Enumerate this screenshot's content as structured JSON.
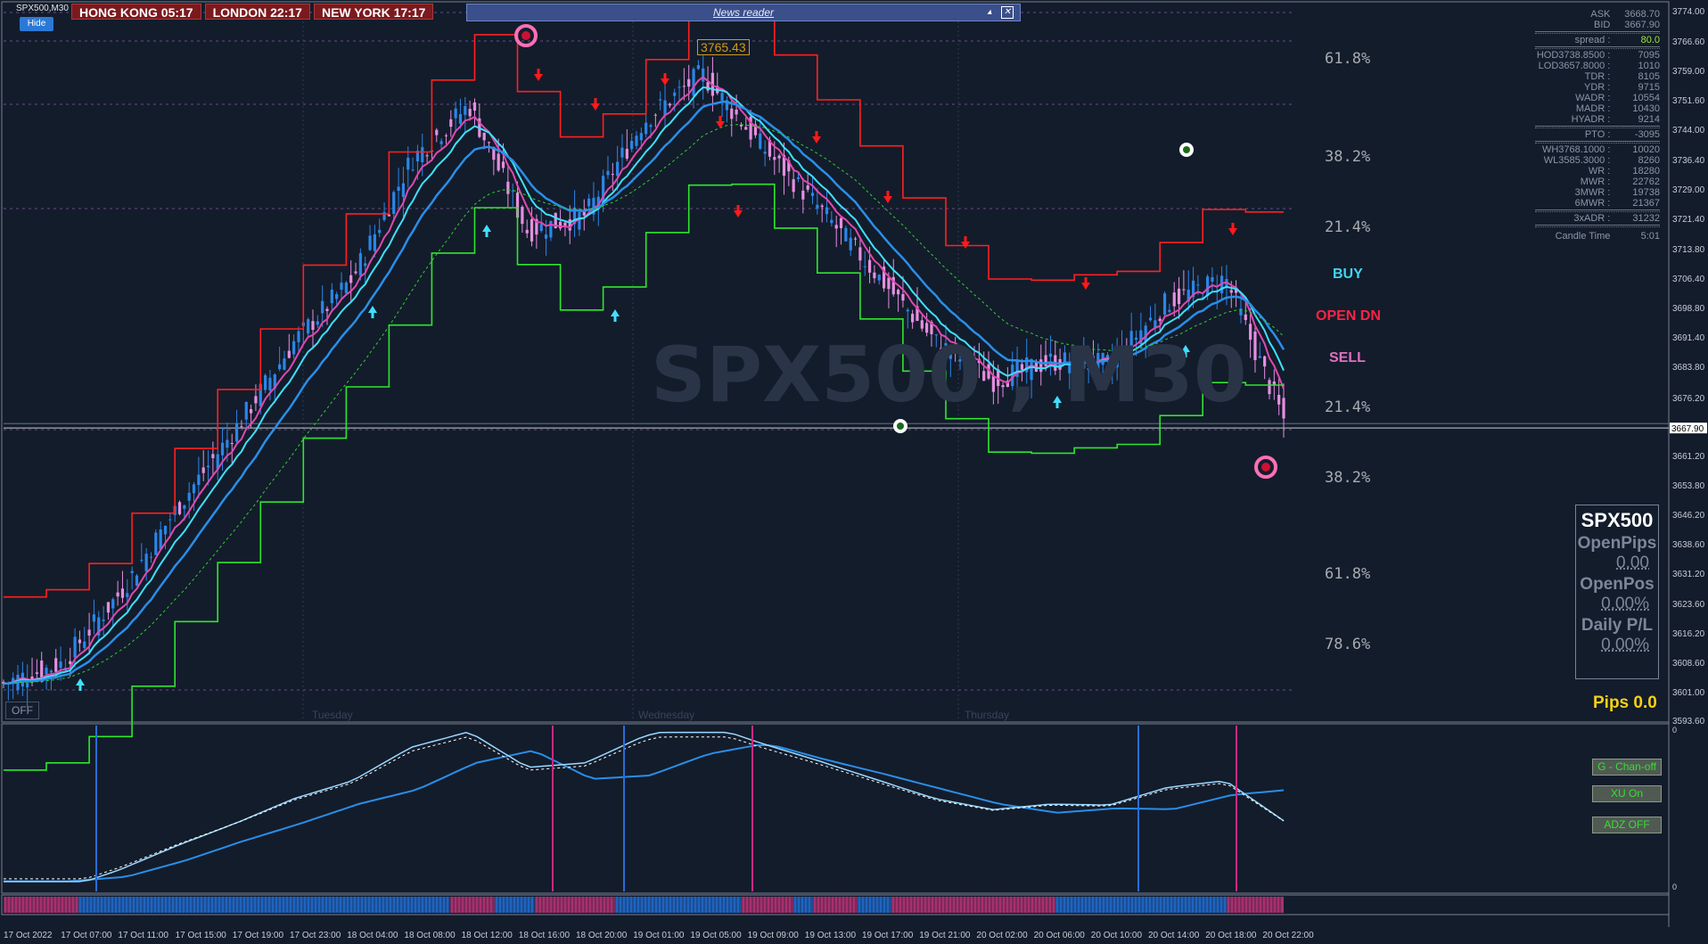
{
  "window": {
    "symbol_title": "SPX500,M30",
    "watermark": "SPX500 , M30"
  },
  "clocks": [
    {
      "label": "HONG KONG 05:17"
    },
    {
      "label": "LONDON  22:17"
    },
    {
      "label": "NEW YORK  17:17"
    }
  ],
  "news_reader": {
    "title": "News reader",
    "minimize": "▴",
    "close": "✕"
  },
  "buttons": {
    "hide": "Hide",
    "off": "OFF",
    "g_chan": "G - Chan-off",
    "xu_on": "XU On",
    "adz_off": "ADZ OFF"
  },
  "price_tag": "3765.43",
  "current_price": "3667.90",
  "signals": {
    "buy": "BUY",
    "open_dn": "OPEN  DN",
    "sell": "SELL"
  },
  "fib_levels": [
    "61.8%",
    "38.2%",
    "21.4%",
    "21.4%",
    "38.2%",
    "61.8%",
    "78.6%"
  ],
  "info_panel": {
    "ask_label": "ASK",
    "ask": "3668.70",
    "bid_label": "BID",
    "bid": "3667.90",
    "spread_label": "spread :",
    "spread": "80.0",
    "rows1": [
      {
        "l": "HOD3738.8500 :",
        "v": "7095"
      },
      {
        "l": "LOD3657.8000 :",
        "v": "1010"
      },
      {
        "l": "TDR :",
        "v": "8105"
      },
      {
        "l": "YDR :",
        "v": "9715"
      },
      {
        "l": "WADR :",
        "v": "10554"
      },
      {
        "l": "MADR :",
        "v": "10430"
      },
      {
        "l": "HYADR :",
        "v": "9214"
      }
    ],
    "pto_label": "PTO :",
    "pto": "-3095",
    "rows2": [
      {
        "l": "WH3768.1000 :",
        "v": "10020"
      },
      {
        "l": "WL3585.3000 :",
        "v": "8260"
      },
      {
        "l": "WR :",
        "v": "18280"
      },
      {
        "l": "MWR :",
        "v": "22762"
      },
      {
        "l": "3MWR :",
        "v": "19738"
      },
      {
        "l": "6MWR :",
        "v": "21367"
      }
    ],
    "xadr_label": "3xADR :",
    "xadr": "31232",
    "candle_label": "Candle Time",
    "candle": "5:01"
  },
  "position_panel": {
    "symbol": "SPX500",
    "open_pips_label": "OpenPips",
    "open_pips": "0.00",
    "open_pos_label": "OpenPos",
    "open_pos": "0.00%",
    "daily_label": "Daily P/L",
    "daily": "0.00%"
  },
  "pips": "Pips 0.0",
  "price_axis": [
    "3774.00",
    "3766.60",
    "3759.00",
    "3751.60",
    "3744.00",
    "3736.40",
    "3729.00",
    "3721.40",
    "3713.80",
    "3706.40",
    "3698.80",
    "3691.40",
    "3683.80",
    "3676.20",
    "3661.20",
    "3653.80",
    "3646.20",
    "3638.60",
    "3631.20",
    "3623.60",
    "3616.20",
    "3608.60",
    "3601.00",
    "3593.60"
  ],
  "sub_axis": [
    "0",
    "0"
  ],
  "day_labels": [
    "Tuesday",
    "Wednesday",
    "Thursday"
  ],
  "time_axis": [
    "17 Oct 2022",
    "17 Oct 07:00",
    "17 Oct 11:00",
    "17 Oct 15:00",
    "17 Oct 19:00",
    "17 Oct 23:00",
    "18 Oct 04:00",
    "18 Oct 08:00",
    "18 Oct 12:00",
    "18 Oct 16:00",
    "18 Oct 20:00",
    "19 Oct 01:00",
    "19 Oct 05:00",
    "19 Oct 09:00",
    "19 Oct 13:00",
    "19 Oct 17:00",
    "19 Oct 21:00",
    "20 Oct 02:00",
    "20 Oct 06:00",
    "20 Oct 10:00",
    "20 Oct 14:00",
    "20 Oct 18:00",
    "20 Oct 22:00"
  ],
  "chart_data": {
    "type": "line",
    "title": "SPX500,M30",
    "ylim": [
      3593.6,
      3774.0
    ],
    "x": [
      "17 Oct 2022",
      "17 Oct 07:00",
      "17 Oct 11:00",
      "17 Oct 15:00",
      "17 Oct 19:00",
      "17 Oct 23:00",
      "18 Oct 04:00",
      "18 Oct 08:00",
      "18 Oct 12:00",
      "18 Oct 16:00",
      "18 Oct 20:00",
      "19 Oct 01:00",
      "19 Oct 05:00",
      "19 Oct 09:00",
      "19 Oct 13:00",
      "19 Oct 17:00",
      "19 Oct 21:00",
      "20 Oct 02:00",
      "20 Oct 06:00",
      "20 Oct 10:00",
      "20 Oct 14:00",
      "20 Oct 18:00",
      "20 Oct 22:00"
    ],
    "series": [
      {
        "values": [
          3603,
          3608,
          3626,
          3648,
          3668,
          3690,
          3706,
          3736,
          3750,
          3718,
          3722,
          3746,
          3758,
          3740,
          3724,
          3707,
          3690,
          3680,
          3685,
          3684,
          3700,
          3706,
          3670
        ]
      }
    ],
    "current": 3667.9,
    "colors": {
      "bull": "#2b86e8",
      "bear": "#e58fe0",
      "up_band": "#2ee62e",
      "dn_band": "#ff2020",
      "ma_pink": "#e048b0",
      "ma_cyan": "#3fe0ff",
      "ma_blue": "#2a8ee8"
    }
  }
}
